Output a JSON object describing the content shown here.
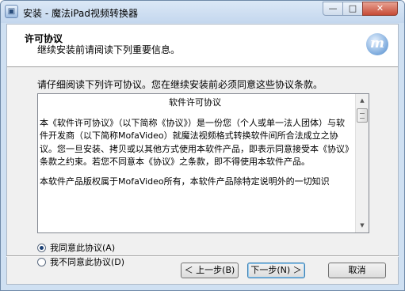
{
  "window": {
    "title": "安装 - 魔法iPad视频转换器",
    "minimize": "—",
    "maximize": "□",
    "close": "✕",
    "app_icon": "安装"
  },
  "header": {
    "title": "许可协议",
    "subtitle": "继续安装前请阅读下列重要信息。",
    "logo": "m",
    "logo_icon": "mofa-logo-icon"
  },
  "intro": "请仔细阅读下列许可协议。您在继续安装前必须同意这些协议条款。",
  "license": {
    "title": "软件许可协议",
    "paragraphs": [
      "本《软件许可协议》（以下简称《协议》）是一份您（个人或单一法人团体）与软件开发商（以下简称MofaVideo）就魔法视频格式转换软件间所合法成立之协议。您一旦安装、拷贝或以其他方式使用本软件产品，即表示同意接受本《协议》条款之约束。若您不同意本《协议》之条款，即不得使用本软件产品。",
      "本软件产品版权属于MofaVideo所有，本软件产品除特定说明外的一切知识"
    ]
  },
  "options": {
    "accept": "我同意此协议(A)",
    "decline": "我不同意此协议(D)",
    "selected": "accept"
  },
  "buttons": {
    "back": "＜ 上一步(B)",
    "next": "下一步(N) ＞",
    "cancel": "取消"
  }
}
